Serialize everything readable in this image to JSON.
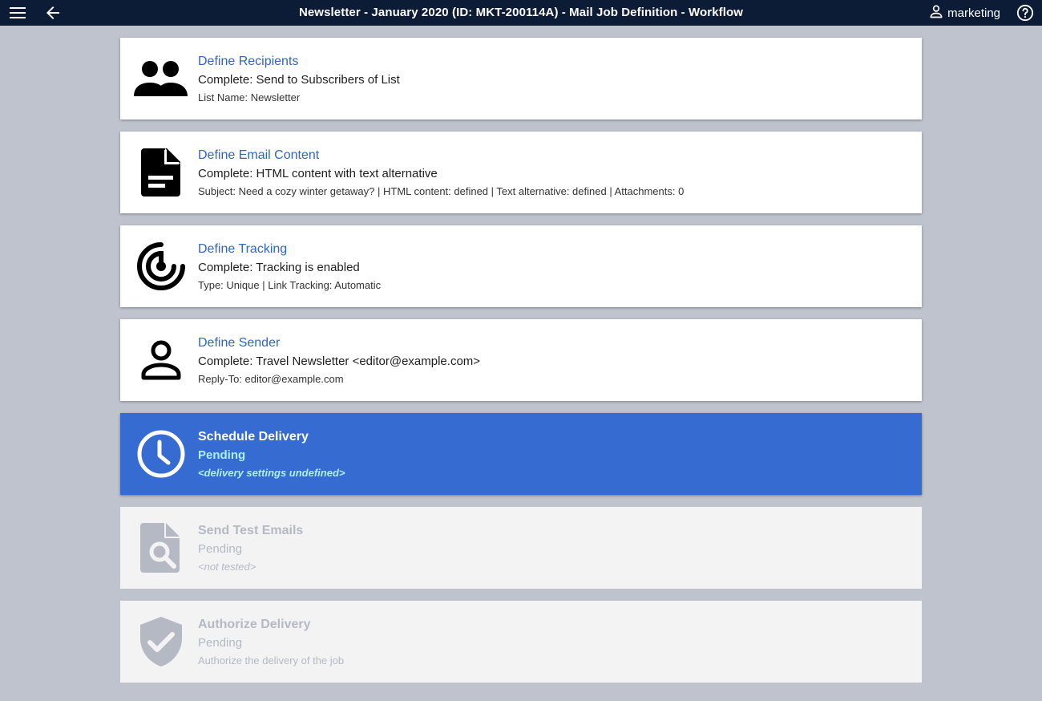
{
  "header": {
    "title": "Newsletter - January 2020 (ID: MKT-200114A) - Mail Job Definition - Workflow",
    "user": "marketing",
    "icons": {
      "menu": "menu-icon",
      "back": "arrow-left-icon",
      "user": "user-icon",
      "help": "help-icon"
    }
  },
  "colors": {
    "topbar": "#0c1b36",
    "background": "#bec3ce",
    "link": "#2f64c9",
    "active": "#366bd1",
    "active_text": "#aef0ff",
    "disabled_text": "#b4b9c4"
  },
  "steps": [
    {
      "icon": "people-icon",
      "state": "complete",
      "heading": "Define Recipients",
      "status": "Complete: Send to Subscribers of List",
      "detail": "List Name: Newsletter"
    },
    {
      "icon": "document-icon",
      "state": "complete",
      "heading": "Define Email Content",
      "status": "Complete: HTML content with text alternative",
      "detail": "Subject: Need a cozy winter getaway? | HTML content: defined | Text alternative: defined | Attachments: 0"
    },
    {
      "icon": "radar-icon",
      "state": "complete",
      "heading": "Define Tracking",
      "status": "Complete: Tracking is enabled",
      "detail": "Type: Unique | Link Tracking: Automatic"
    },
    {
      "icon": "person-icon",
      "state": "complete",
      "heading": "Define Sender",
      "status": "Complete: Travel Newsletter <editor@example.com>",
      "detail": "Reply-To: editor@example.com"
    },
    {
      "icon": "clock-icon",
      "state": "active",
      "heading": "Schedule Delivery",
      "status": "Pending",
      "detail": "<delivery settings undefined>"
    },
    {
      "icon": "file-search-icon",
      "state": "disabled",
      "heading": "Send Test Emails",
      "status": "Pending",
      "detail": "<not tested>"
    },
    {
      "icon": "shield-check-icon",
      "state": "disabled",
      "heading": "Authorize Delivery",
      "status": "Pending",
      "detail": "Authorize the delivery of the job"
    }
  ]
}
